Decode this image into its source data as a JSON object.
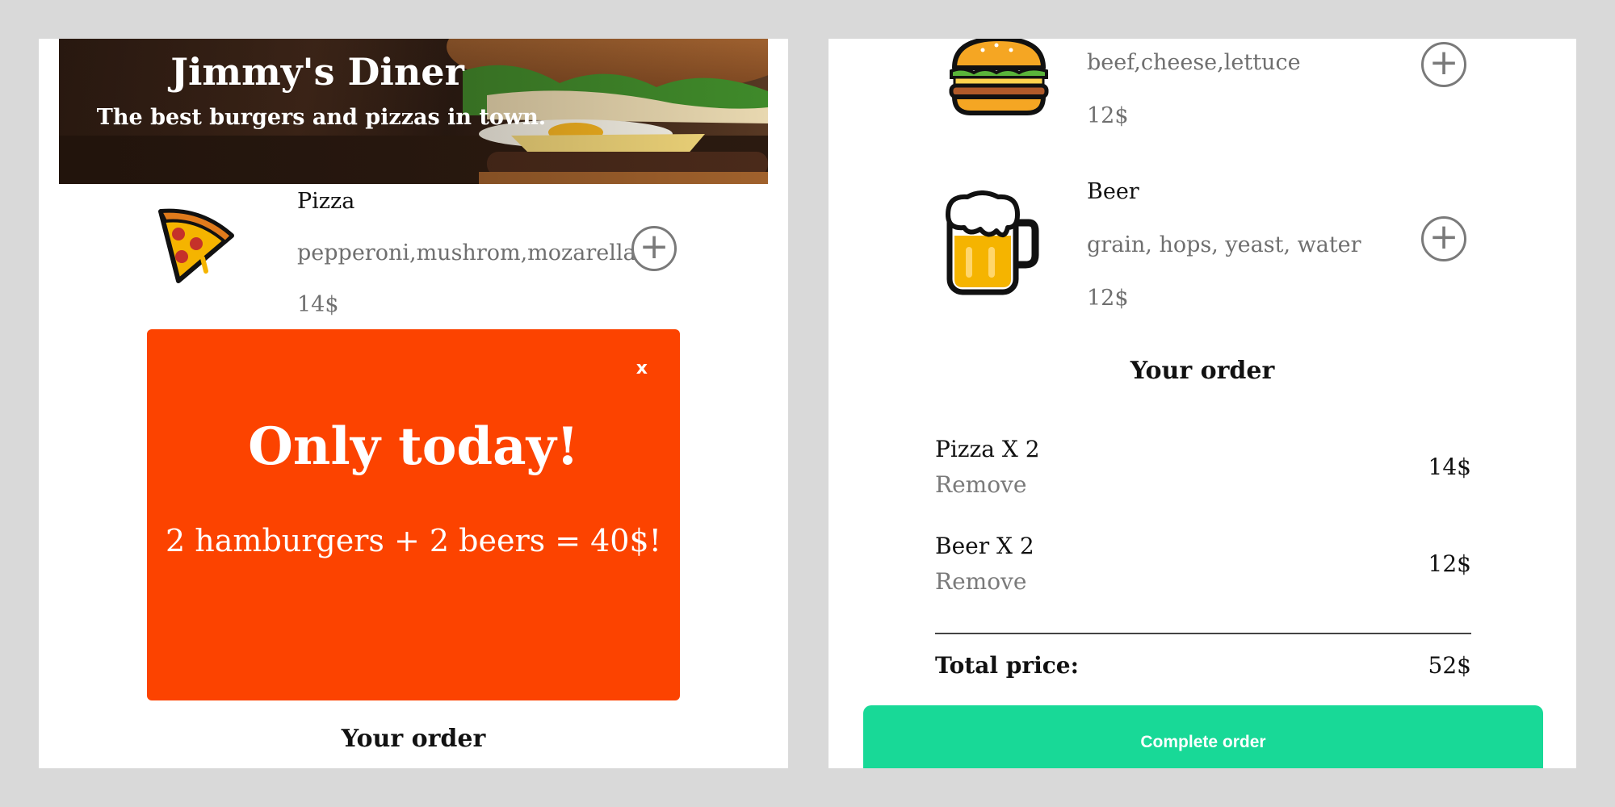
{
  "header": {
    "title": "Jimmy's Diner",
    "subtitle": "The best burgers and pizzas in town."
  },
  "menu": {
    "pizza": {
      "name": "Pizza",
      "ingredients": "pepperoni,mushrom,mozarella",
      "price": "14$",
      "icon": "pizza-slice-icon"
    },
    "hamburger": {
      "ingredients": "beef,cheese,lettuce",
      "price": "12$",
      "icon": "hamburger-icon"
    },
    "beer": {
      "name": "Beer",
      "ingredients": "grain, hops, yeast, water",
      "price": "12$",
      "icon": "beer-mug-icon"
    },
    "add_label": "+"
  },
  "modal": {
    "close": "x",
    "title": "Only today!",
    "text": "2 hamburgers + 2 beers = 40$!"
  },
  "order": {
    "title": "Your order",
    "items": [
      {
        "name": "Pizza X 2",
        "remove": "Remove",
        "price": "14$"
      },
      {
        "name": "Beer X 2",
        "remove": "Remove",
        "price": "12$"
      }
    ],
    "total_label": "Total price:",
    "total_value": "52$",
    "complete_label": "Complete order"
  },
  "colors": {
    "background": "#d9d9d9",
    "modal": "#fc4300",
    "button": "#18d997"
  }
}
